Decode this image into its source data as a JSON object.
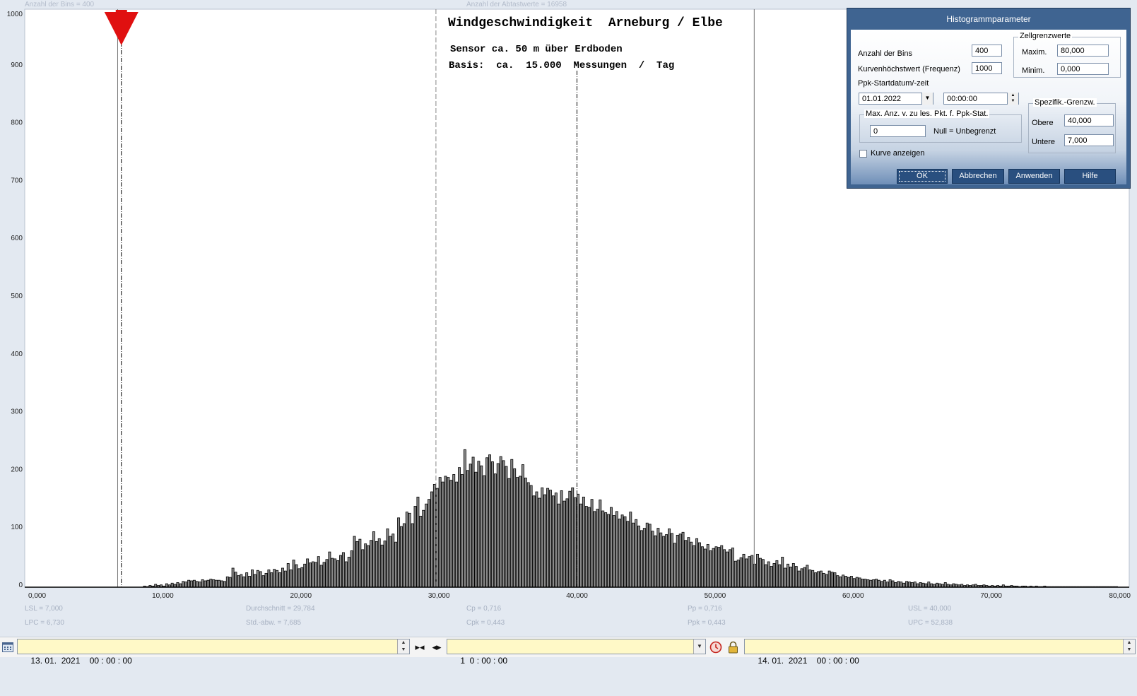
{
  "header": {
    "bins_label": "Anzahl der Bins =   400",
    "samples_label": "Anzahl der Abtastwerte = 16958"
  },
  "title": {
    "line1": "Windgeschwindigkeit  Arneburg / Elbe",
    "line2": "Sensor ca. 50 m über Erdboden",
    "line3": "Basis:  ca.  15.000  Messungen  /  Tag"
  },
  "stats": {
    "lsl": "LSL = 7,000",
    "lpc": "LPC = 6,730",
    "mean": "Durchschnitt  = 29,784",
    "std": "Std.-abw.  = 7,685",
    "cp": "Cp  = 0,716",
    "cpk": "Cpk = 0,443",
    "pp": "Pp  = 0,716",
    "ppk": "Ppk = 0,443",
    "usl": "USL = 40,000",
    "upc": "UPC = 52,838"
  },
  "chart_data": {
    "type": "bar",
    "x_ticks": [
      "0,000",
      "10,000",
      "20,000",
      "30,000",
      "40,000",
      "50,000",
      "60,000",
      "70,000",
      "80,000"
    ],
    "y_ticks": [
      "0",
      "100",
      "200",
      "300",
      "400",
      "500",
      "600",
      "700",
      "800",
      "900",
      "1000"
    ],
    "xlim": [
      0,
      80
    ],
    "ylim": [
      0,
      1000
    ],
    "bin_width": 0.2,
    "bins_start": 8.6,
    "values": [
      2,
      1,
      3,
      2,
      5,
      3,
      4,
      2,
      6,
      4,
      7,
      5,
      8,
      6,
      10,
      9,
      12,
      11,
      12,
      10,
      9,
      13,
      11,
      12,
      14,
      13,
      12,
      12,
      11,
      10,
      18,
      17,
      33,
      26,
      20,
      22,
      18,
      25,
      19,
      30,
      22,
      29,
      27,
      20,
      24,
      30,
      25,
      31,
      29,
      25,
      33,
      28,
      41,
      30,
      47,
      39,
      32,
      34,
      40,
      49,
      42,
      44,
      43,
      53,
      38,
      43,
      48,
      61,
      50,
      49,
      46,
      55,
      60,
      44,
      52,
      63,
      88,
      79,
      83,
      65,
      75,
      72,
      81,
      96,
      79,
      84,
      73,
      80,
      101,
      88,
      92,
      78,
      120,
      105,
      110,
      130,
      128,
      110,
      140,
      156,
      123,
      133,
      144,
      152,
      165,
      178,
      171,
      190,
      182,
      192,
      190,
      185,
      195,
      182,
      207,
      195,
      238,
      202,
      213,
      225,
      199,
      218,
      210,
      193,
      224,
      229,
      217,
      196,
      214,
      226,
      219,
      209,
      188,
      221,
      205,
      190,
      192,
      212,
      189,
      181,
      176,
      158,
      165,
      154,
      172,
      160,
      171,
      168,
      158,
      163,
      144,
      167,
      149,
      153,
      166,
      172,
      155,
      161,
      144,
      156,
      140,
      138,
      152,
      131,
      135,
      151,
      132,
      129,
      126,
      138,
      124,
      131,
      118,
      125,
      122,
      114,
      130,
      111,
      117,
      106,
      98,
      102,
      111,
      109,
      97,
      89,
      102,
      94,
      88,
      91,
      101,
      93,
      76,
      90,
      92,
      95,
      81,
      86,
      78,
      72,
      84,
      77,
      70,
      66,
      74,
      63,
      67,
      70,
      69,
      72,
      65,
      61,
      65,
      68,
      45,
      47,
      51,
      57,
      49,
      53,
      55,
      40,
      57,
      50,
      48,
      39,
      44,
      36,
      41,
      46,
      39,
      52,
      33,
      40,
      35,
      41,
      36,
      28,
      32,
      34,
      38,
      30,
      29,
      25,
      27,
      28,
      24,
      22,
      28,
      26,
      25,
      20,
      18,
      21,
      19,
      17,
      19,
      15,
      17,
      16,
      14,
      14,
      13,
      12,
      13,
      14,
      12,
      10,
      12,
      9,
      13,
      11,
      8,
      10,
      9,
      7,
      10,
      9,
      8,
      9,
      6,
      8,
      7,
      6,
      9,
      6,
      5,
      7,
      6,
      5,
      8,
      5,
      4,
      6,
      5,
      4,
      5,
      3,
      4,
      3,
      4,
      5,
      3,
      3,
      4,
      3,
      2,
      3,
      2,
      3,
      2,
      4,
      2,
      2,
      3,
      2,
      2,
      1,
      2,
      2,
      1,
      2,
      1,
      2,
      1,
      1,
      2,
      1,
      1,
      1,
      1,
      1,
      1,
      1,
      1,
      1,
      1,
      1,
      1,
      1,
      1,
      1,
      1,
      1,
      1,
      1,
      1,
      1,
      1,
      1,
      1,
      1,
      1
    ],
    "reference_lines": {
      "lpc": 6.73,
      "lsl": 7.0,
      "usl": 40.0,
      "upc": 52.838,
      "mid": 29.784
    }
  },
  "dialog": {
    "title": "Histogrammparameter",
    "bins_label": "Anzahl der Bins",
    "bins_value": "400",
    "freq_label": "Kurvenhöchstwert (Frequenz)",
    "freq_value": "1000",
    "start_label": "Ppk-Startdatum/-zeit",
    "start_date": "01.01.2022",
    "start_time": "00:00:00",
    "cell_group": "Zellgrenzwerte",
    "max_label": "Maxim.",
    "max_value": "80,000",
    "min_label": "Minim.",
    "min_value": "0,000",
    "maxpts_group": "Max. Anz. v. zu les. Pkt. f. Ppk-Stat.",
    "maxpts_value": "0",
    "null_note": "Null = Unbegrenzt",
    "spec_group": "Spezifik.-Grenzw.",
    "upper_label": "Obere",
    "upper_value": "40,000",
    "lower_label": "Untere",
    "lower_value": "7,000",
    "curve_label": "Kurve anzeigen",
    "ok": "OK",
    "cancel": "Abbrechen",
    "apply": "Anwenden",
    "help": "Hilfe"
  },
  "bottom": {
    "start": "13. 01.  2021    00 : 00 : 00",
    "interval": "1  0 : 00 : 00",
    "end": "14. 01.  2021    00 : 00 : 00"
  },
  "colors": {
    "marker": "#e01010",
    "bar_fill": "#8a8a8a",
    "accent": "#3f6491",
    "field": "#fff9c7"
  }
}
